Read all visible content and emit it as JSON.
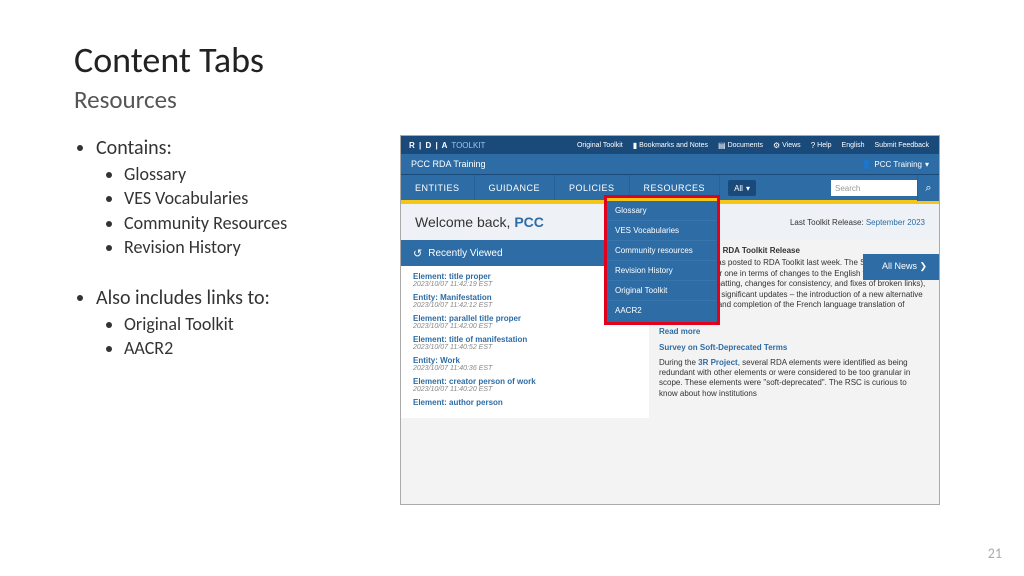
{
  "slide": {
    "title": "Content Tabs",
    "subtitle": "Resources",
    "pageNumber": "21",
    "bullets": {
      "heading1": "Contains:",
      "items1": [
        "Glossary",
        "VES Vocabularies",
        "Community Resources",
        "Revision History"
      ],
      "heading2": "Also includes links to:",
      "items2": [
        "Original Toolkit",
        "AACR2"
      ]
    }
  },
  "screenshot": {
    "logo": {
      "prefix": "R | D | A",
      "suffix": "TOOLKIT"
    },
    "topLinks": [
      "Original Toolkit",
      "Bookmarks and Notes",
      "Documents",
      "Views",
      "Help",
      "English",
      "Submit Feedback"
    ],
    "pccBar": {
      "title": "PCC RDA Training",
      "user": "PCC Training"
    },
    "nav": {
      "tabs": [
        "ENTITIES",
        "GUIDANCE",
        "POLICIES",
        "RESOURCES"
      ],
      "allLabel": "All",
      "searchPlaceholder": "Search"
    },
    "dropdown": [
      "Glossary",
      "VES Vocabularies",
      "Community resources",
      "Revision History",
      "Original Toolkit",
      "AACR2"
    ],
    "welcome": {
      "text": "Welcome back, ",
      "user": "PCC",
      "releaseLabel": "Last Toolkit Release:",
      "releaseDate": "September 2023"
    },
    "recent": {
      "header": "Recently Viewed",
      "items": [
        {
          "label": "Element: title proper",
          "ts": "2023/10/07 11:42:19 EST"
        },
        {
          "label": "Entity: Manifestation",
          "ts": "2023/10/07 11:42:12 EST"
        },
        {
          "label": "Element: parallel title proper",
          "ts": "2023/10/07 11:42:00 EST"
        },
        {
          "label": "Element: title of manifestation",
          "ts": "2023/10/07 11:40:52 EST"
        },
        {
          "label": "Entity: Work",
          "ts": "2023/10/07 11:40:36 EST"
        },
        {
          "label": "Element: creator person of work",
          "ts": "2023/10/07 11:40:20 EST"
        },
        {
          "label": "Element: author person",
          "ts": ""
        }
      ]
    },
    "news": {
      "header": "All News  ❯",
      "title": "September 2023 RDA Toolkit Release",
      "body": "A new release was posted to RDA Toolkit last week. The September 2023 release is a minor one in terms of changes to the English text (corrections to typos and formatting, changes for consistency, and fixes of broken links), but there are two significant updates – the introduction of a new alternative Guidance menu and completion of the French language translation of official RDA.",
      "more": "Read more",
      "subTitle": "Survey on Soft-Deprecated Terms",
      "subLink": "3R Project",
      "subBodyPrefix": "During the ",
      "subBodySuffix": ", several RDA elements were identified as being redundant with other elements or were considered to be too granular in scope. These elements were \"soft-deprecated\". The RSC is curious to know about how institutions"
    }
  }
}
